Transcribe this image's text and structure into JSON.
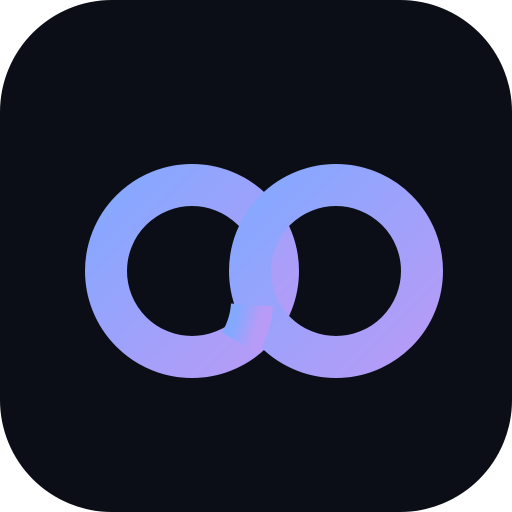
{
  "app_icon": {
    "name": "interlocking-rings-app-icon",
    "glyph": "interlocking-rings-icon",
    "colors": {
      "background": "#0b0e16",
      "gradient_start": "#84a8ff",
      "gradient_end": "#b79bf6"
    }
  }
}
